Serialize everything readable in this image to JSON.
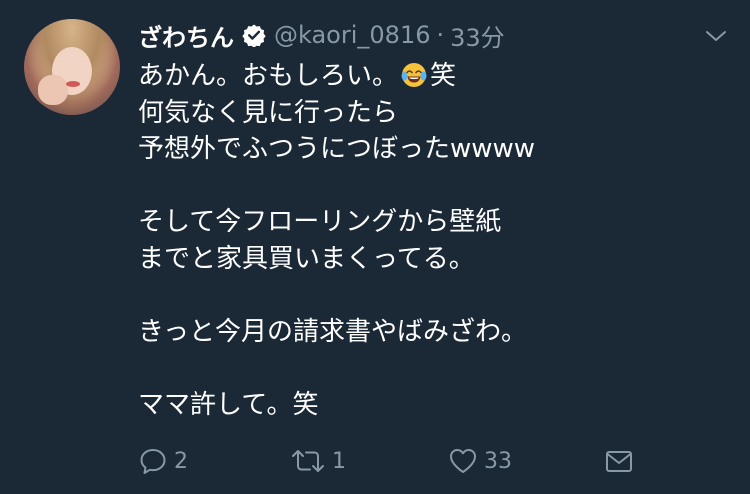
{
  "tweet": {
    "display_name": "ざわちん",
    "handle": "@kaori_0816",
    "separator": "·",
    "time": "33分",
    "lines": [
      {
        "text_before": "あかん。おもしろい。",
        "text_after": "笑"
      },
      "何気なく見に行ったら",
      "予想外でふつうにつぼったwwww",
      "",
      "そして今フローリングから壁紙",
      "までと家具買いまくってる。",
      "",
      "きっと今月の請求書やばみざわ。",
      "",
      "ママ許して。笑"
    ],
    "emoji_name": "face-with-tears-of-joy",
    "actions": {
      "reply_count": "2",
      "retweet_count": "1",
      "like_count": "33"
    }
  },
  "colors": {
    "background": "#1b2836",
    "text_primary": "#ffffff",
    "text_secondary": "#8899a6",
    "verified_fill": "#ffffff"
  },
  "icons": {
    "verified": "verified-badge-icon",
    "menu": "chevron-down-icon",
    "reply": "reply-icon",
    "retweet": "retweet-icon",
    "like": "heart-icon",
    "dm": "envelope-icon"
  }
}
